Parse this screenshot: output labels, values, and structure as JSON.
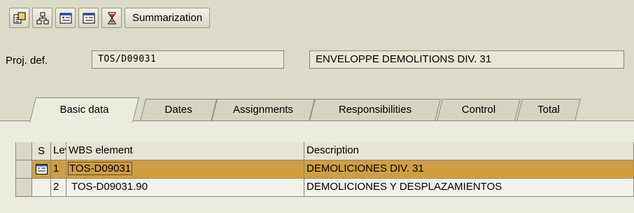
{
  "toolbar": {
    "buttons": [
      {
        "icon": "view-switch-icon"
      },
      {
        "icon": "hierarchy-icon"
      },
      {
        "icon": "expand-tree-icon"
      },
      {
        "icon": "collapse-tree-icon"
      },
      {
        "icon": "filter-icon"
      }
    ],
    "summarization_label": "Summarization"
  },
  "header": {
    "proj_def_label": "Proj. def.",
    "proj_def_value": "TOS/D09031",
    "proj_desc_value": "ENVELOPPE DEMOLITIONS DIV. 31"
  },
  "tabs": [
    {
      "label": "Basic data",
      "active": true
    },
    {
      "label": "Dates"
    },
    {
      "label": "Assignments"
    },
    {
      "label": "Responsibilities"
    },
    {
      "label": "Control"
    },
    {
      "label": "Total"
    }
  ],
  "table": {
    "columns": [
      "S",
      "Lev",
      "WBS element",
      "Description"
    ],
    "rows": [
      {
        "level": "1",
        "wbs": "TOS-D09031",
        "desc": "DEMOLICIONES DIV. 31",
        "status_icon": "hierarchy-node-icon",
        "highlight_color": "#d09e40"
      },
      {
        "level": "2",
        "wbs": "TOS-D09031.90",
        "desc": "DEMOLICIONES Y DESPLAZAMIENTOS"
      }
    ]
  }
}
